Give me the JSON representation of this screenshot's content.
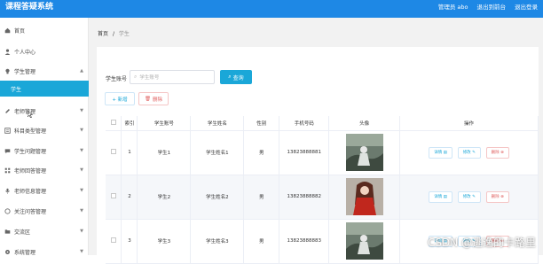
{
  "header": {
    "app_title": "课程答疑系统",
    "admin_label": "管理员 abo",
    "exit_to_front": "退出到前台",
    "logout": "退出登录"
  },
  "sidebar": {
    "items": [
      {
        "label": "首页",
        "icon": "home-icon"
      },
      {
        "label": "个人中心",
        "icon": "user-icon"
      },
      {
        "label": "学生管理",
        "icon": "bulb-icon"
      },
      {
        "label": "学生",
        "icon": ""
      },
      {
        "label": "老师管理",
        "icon": "pencil-icon"
      },
      {
        "label": "科目类型管理",
        "icon": "list-icon"
      },
      {
        "label": "学生问题管理",
        "icon": "chat-icon"
      },
      {
        "label": "老师回答管理",
        "icon": "grid-icon"
      },
      {
        "label": "老师信息管理",
        "icon": "mic-icon"
      },
      {
        "label": "关注问答管理",
        "icon": "star-icon"
      },
      {
        "label": "交流区",
        "icon": "folder-icon"
      },
      {
        "label": "系统管理",
        "icon": "gear-icon"
      }
    ],
    "accent_color": "#1aa7d8"
  },
  "breadcrumb": {
    "home": "首页",
    "separator": "/",
    "current": "学生"
  },
  "search": {
    "label": "学生账号",
    "placeholder": "学生账号",
    "button": "查询"
  },
  "actions": {
    "add": "+ 新增",
    "delete": "删除"
  },
  "table": {
    "columns": [
      "索引",
      "学生账号",
      "学生姓名",
      "性别",
      "手机号码",
      "头像",
      "操作"
    ],
    "rows": [
      {
        "index": "1",
        "account": "学生1",
        "name": "学生姓名1",
        "gender": "男",
        "phone": "13823888881"
      },
      {
        "index": "2",
        "account": "学生2",
        "name": "学生姓名2",
        "gender": "男",
        "phone": "13823888882"
      },
      {
        "index": "3",
        "account": "学生3",
        "name": "学生姓名3",
        "gender": "男",
        "phone": "13823888883"
      }
    ],
    "op_labels": {
      "detail": "详情",
      "edit": "修改",
      "delete": "删除"
    }
  },
  "watermark": "CSDN @逃逸的卡路里"
}
